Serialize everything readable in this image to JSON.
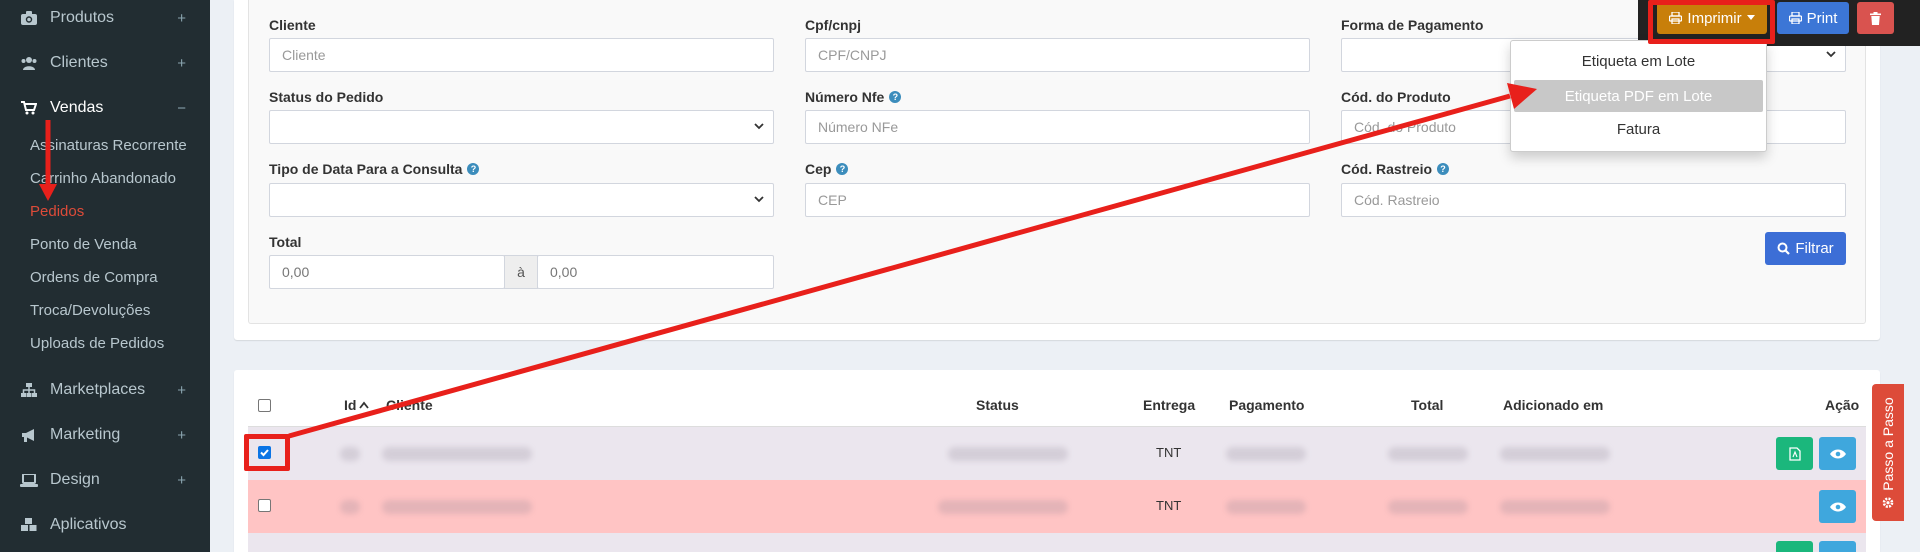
{
  "sidebar": {
    "menu": [
      {
        "label": "Produtos",
        "sign": "+",
        "icon": "camera-icon"
      },
      {
        "label": "Clientes",
        "sign": "+",
        "icon": "users-icon"
      },
      {
        "label": "Vendas",
        "sign": "−",
        "icon": "cart-icon"
      },
      {
        "label": "Marketplaces",
        "sign": "+",
        "icon": "sitemap-icon"
      },
      {
        "label": "Marketing",
        "sign": "+",
        "icon": "bullhorn-icon"
      },
      {
        "label": "Design",
        "sign": "+",
        "icon": "laptop-icon"
      },
      {
        "label": "Aplicativos",
        "sign": "",
        "icon": "cubes-icon"
      }
    ],
    "submenu": [
      "Assinaturas Recorrente",
      "Carrinho Abandonado",
      "Pedidos",
      "Ponto de Venda",
      "Ordens de Compra",
      "Troca/Devoluções",
      "Uploads de Pedidos"
    ]
  },
  "filters": {
    "cliente_label": "Cliente",
    "cliente_placeholder": "Cliente",
    "cpf_label": "Cpf/cnpj",
    "cpf_placeholder": "CPF/CNPJ",
    "pagamento_label": "Forma de Pagamento",
    "status_label": "Status do Pedido",
    "nfe_label": "Número Nfe",
    "nfe_placeholder": "Número NFe",
    "produto_label": "Cód. do Produto",
    "produto_placeholder": "Cód. do Produto",
    "tipo_data_label": "Tipo de Data Para a Consulta",
    "cep_label": "Cep",
    "cep_placeholder": "CEP",
    "rastreio_label": "Cód. Rastreio",
    "rastreio_placeholder": "Cód. Rastreio",
    "total_label": "Total",
    "total_min": "0,00",
    "total_sep": "à",
    "total_max": "0,00",
    "filter_button": "Filtrar"
  },
  "toolbar": {
    "imprimir_label": "Imprimir",
    "print_label": "Print"
  },
  "dropdown": {
    "items": [
      "Etiqueta em Lote",
      "Etiqueta PDF em Lote",
      "Fatura"
    ]
  },
  "table": {
    "headers": {
      "id": "Id",
      "cliente": "Cliente",
      "status": "Status",
      "entrega": "Entrega",
      "pagamento": "Pagamento",
      "total": "Total",
      "adicionado": "Adicionado em",
      "acao": "Ação"
    },
    "rows": [
      {
        "entrega": "TNT",
        "checked": true
      },
      {
        "entrega": "TNT",
        "checked": false
      }
    ]
  },
  "passo_label": "Passo a Passo",
  "colors": {
    "sidebar_bg": "#222d32",
    "active_red": "#dd4b39",
    "imprimir_bg": "#c87f0a",
    "print_bg": "#3c76d6",
    "delete_bg": "#d9534f",
    "filter_bg": "#3c6ed6",
    "green_btn": "#1bb77c",
    "blue_btn": "#3fa7dd",
    "row_danger": "#ffc4c4",
    "annotation": "#e8201b"
  }
}
